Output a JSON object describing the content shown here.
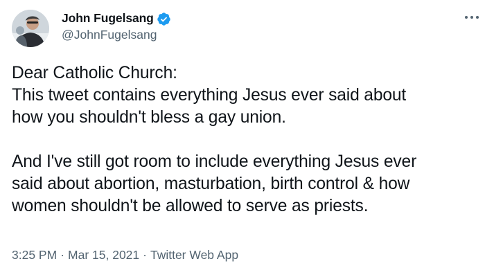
{
  "author": {
    "display_name": "John Fugelsang",
    "handle": "@JohnFugelsang",
    "verified": true,
    "avatar_icon": "profile-photo"
  },
  "menu": {
    "more_icon": "ellipsis-icon"
  },
  "tweet": {
    "lines": [
      "Dear Catholic Church:",
      "This tweet contains everything Jesus ever said about",
      "how you shouldn't bless a gay union.",
      "",
      "And I've still got room to include everything Jesus ever",
      "said about abortion, masturbation, birth control & how",
      "women shouldn't be allowed to serve as priests."
    ]
  },
  "meta": {
    "time": "3:25 PM",
    "separator": "·",
    "date": "Mar 15, 2021",
    "source": "Twitter Web App"
  },
  "colors": {
    "text": "#0f1419",
    "secondary": "#536471",
    "verified": "#1d9bf0"
  }
}
